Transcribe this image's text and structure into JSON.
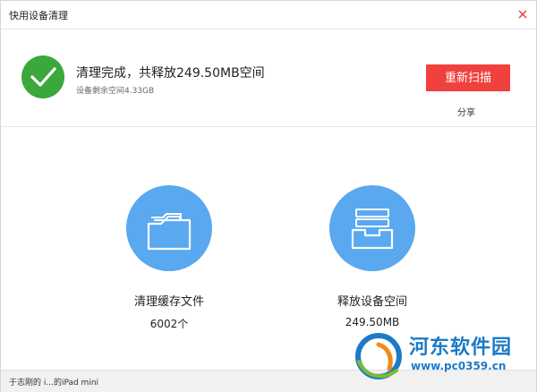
{
  "window": {
    "title": "快用设备清理"
  },
  "header": {
    "headline": "清理完成，共释放249.50MB空间",
    "subline": "设备剩余空间4.33GB",
    "rescan_label": "重新扫描",
    "share_label": "分享"
  },
  "stats": [
    {
      "label": "清理缓存文件",
      "value": "6002个",
      "icon": "folder-icon"
    },
    {
      "label": "释放设备空间",
      "value": "249.50MB",
      "icon": "inbox-tray-icon"
    }
  ],
  "statusbar": {
    "text": "于志刚的 i...的iPad mini"
  },
  "watermark": {
    "name": "河东软件园",
    "url": "www.pc0359.cn"
  },
  "colors": {
    "success": "#3aa83a",
    "primary_button": "#f0413e",
    "stat_circle": "#5aa8ef",
    "watermark": "#1c7ac8"
  }
}
